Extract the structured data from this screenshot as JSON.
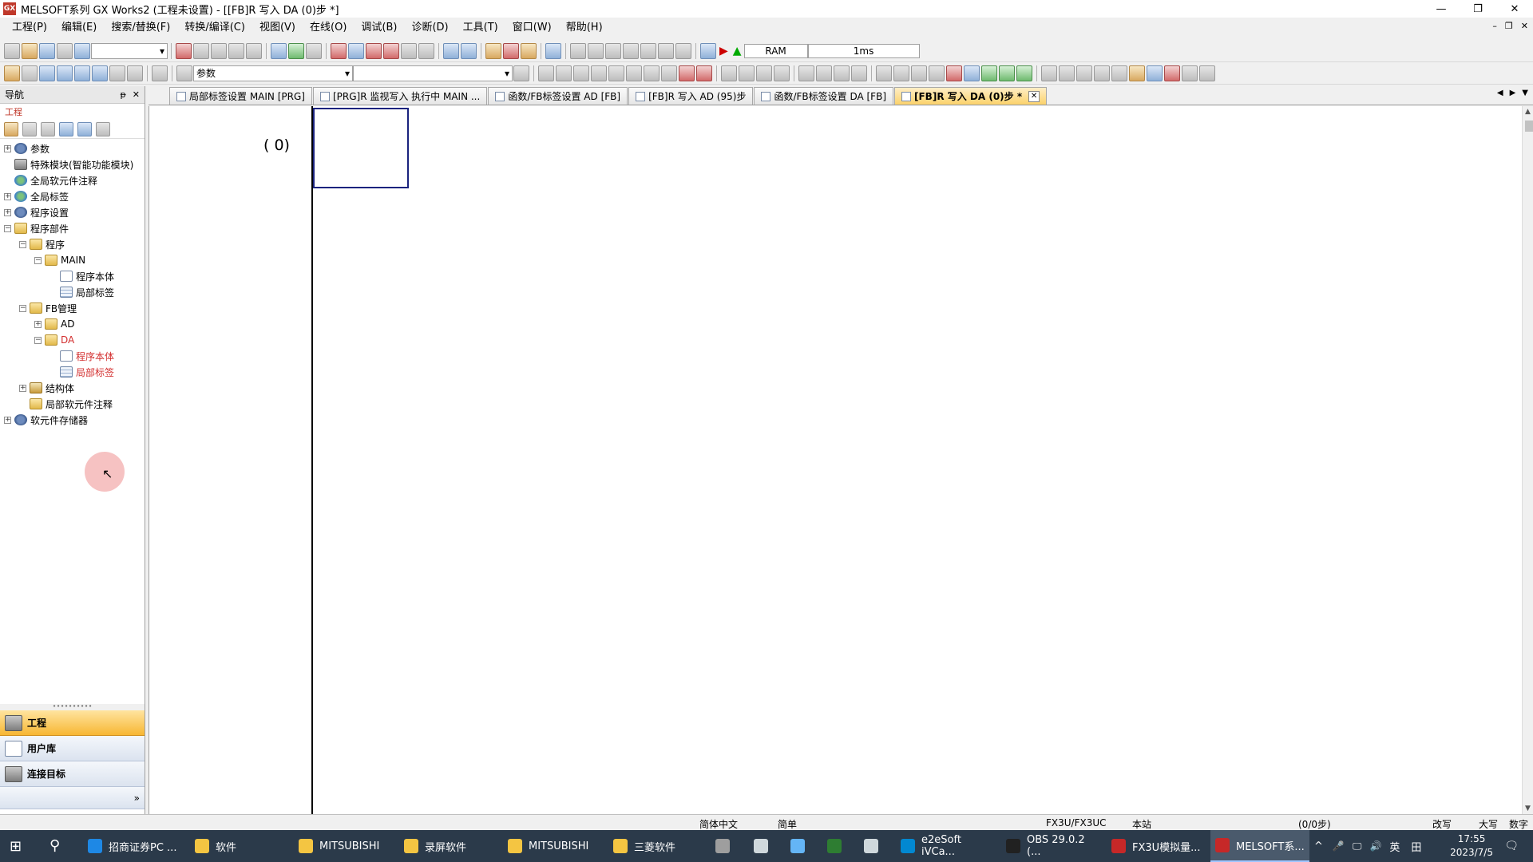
{
  "window": {
    "app_icon_text": "GX",
    "title": "MELSOFT系列 GX Works2 (工程未设置) - [[FB]R 写入 DA (0)步 *]",
    "minimize": "—",
    "maximize": "❐",
    "close": "✕"
  },
  "menu": {
    "items": [
      "工程(P)",
      "编辑(E)",
      "搜索/替换(F)",
      "转换/编译(C)",
      "视图(V)",
      "在线(O)",
      "调试(B)",
      "诊断(D)",
      "工具(T)",
      "窗口(W)",
      "帮助(H)"
    ],
    "mdi_min": "–",
    "mdi_restore": "❐",
    "mdi_close": "✕"
  },
  "toolbar": {
    "combo1_value": "",
    "ram_label": "RAM",
    "scan_time": "1ms",
    "search_combo_value": "参数"
  },
  "nav": {
    "title": "导航",
    "pin": "ᵽ",
    "close": "✕",
    "section_label": "工程",
    "tree": [
      {
        "label": "参数",
        "level": 0,
        "exp": "+",
        "icon": "i-gear"
      },
      {
        "label": "特殊模块(智能功能模块)",
        "level": 0,
        "exp": "",
        "icon": "i-module"
      },
      {
        "label": "全局软元件注释",
        "level": 0,
        "exp": "",
        "icon": "i-globe"
      },
      {
        "label": "全局标签",
        "level": 0,
        "exp": "+",
        "icon": "i-globe"
      },
      {
        "label": "程序设置",
        "level": 0,
        "exp": "+",
        "icon": "i-gear"
      },
      {
        "label": "程序部件",
        "level": 0,
        "exp": "−",
        "icon": "i-folder"
      },
      {
        "label": "程序",
        "level": 1,
        "exp": "−",
        "icon": "i-folder"
      },
      {
        "label": "MAIN",
        "level": 2,
        "exp": "−",
        "icon": "i-folder"
      },
      {
        "label": "程序本体",
        "level": 3,
        "exp": "",
        "icon": "i-doc"
      },
      {
        "label": "局部标签",
        "level": 3,
        "exp": "",
        "icon": "i-table"
      },
      {
        "label": "FB管理",
        "level": 1,
        "exp": "−",
        "icon": "i-folder"
      },
      {
        "label": "AD",
        "level": 2,
        "exp": "+",
        "icon": "i-folder"
      },
      {
        "label": "DA",
        "level": 2,
        "exp": "−",
        "icon": "i-folder",
        "red": true
      },
      {
        "label": "程序本体",
        "level": 3,
        "exp": "",
        "icon": "i-doc",
        "red": true
      },
      {
        "label": "局部标签",
        "level": 3,
        "exp": "",
        "icon": "i-table",
        "red": true
      },
      {
        "label": "结构体",
        "level": 1,
        "exp": "+",
        "icon": "i-struct"
      },
      {
        "label": "局部软元件注释",
        "level": 1,
        "exp": "",
        "icon": "i-folder"
      },
      {
        "label": "软元件存储器",
        "level": 0,
        "exp": "+",
        "icon": "i-gear"
      }
    ],
    "grip": "∙∙∙∙∙∙∙∙∙∙",
    "bottom_buttons": [
      {
        "label": "工程",
        "active": true
      },
      {
        "label": "用户库",
        "active": false
      },
      {
        "label": "连接目标",
        "active": false
      }
    ],
    "collapse_glyph": "»"
  },
  "tabs": {
    "items": [
      {
        "label": "局部标签设置 MAIN [PRG]",
        "active": false
      },
      {
        "label": "[PRG]R 监视写入 执行中 MAIN ...",
        "active": false
      },
      {
        "label": "函数/FB标签设置 AD [FB]",
        "active": false
      },
      {
        "label": "[FB]R 写入 AD (95)步",
        "active": false
      },
      {
        "label": "函数/FB标签设置 DA [FB]",
        "active": false
      },
      {
        "label": "[FB]R 写入 DA (0)步 *",
        "active": true
      }
    ],
    "close_glyph": "✕",
    "nav_prev": "◀",
    "nav_next": "▶",
    "nav_menu": "▼"
  },
  "editor": {
    "step_label": "(    0)"
  },
  "statusbar": {
    "language": "简体中文",
    "mode": "简单",
    "plc_type": "FX3U/FX3UC",
    "station": "本站",
    "steps": "(0/0步)",
    "overwrite": "改写",
    "caps": "大写",
    "numlock": "数字"
  },
  "taskbar": {
    "start": "⊞",
    "search": "⚲",
    "items": [
      {
        "label": "招商证券PC ...",
        "color": "#1e88e5"
      },
      {
        "label": "软件",
        "color": "#f4c542"
      },
      {
        "label": "MITSUBISHI",
        "color": "#f4c542"
      },
      {
        "label": "录屏软件",
        "color": "#f4c542"
      },
      {
        "label": "MITSUBISHI",
        "color": "#f4c542"
      },
      {
        "label": "三菱软件",
        "color": "#f4c542"
      },
      {
        "label": "",
        "color": "#9e9e9e"
      },
      {
        "label": "",
        "color": "#cfd8dc"
      },
      {
        "label": "",
        "color": "#64b5f6"
      },
      {
        "label": "",
        "color": "#2e7d32"
      },
      {
        "label": "",
        "color": "#cfd8dc"
      },
      {
        "label": "e2eSoft iVCa...",
        "color": "#0288d1"
      },
      {
        "label": "OBS 29.0.2 (...",
        "color": "#212121"
      },
      {
        "label": "FX3U模拟量...",
        "color": "#c62828"
      },
      {
        "label": "MELSOFT系...",
        "color": "#c62828",
        "active": true
      }
    ],
    "tray": {
      "up": "^",
      "mic": "🎤",
      "net": "🖵",
      "vol": "🔊",
      "ime": "英",
      "ime2": "田",
      "time": "17:55",
      "date": "2023/7/5",
      "notify": "🗨"
    }
  }
}
